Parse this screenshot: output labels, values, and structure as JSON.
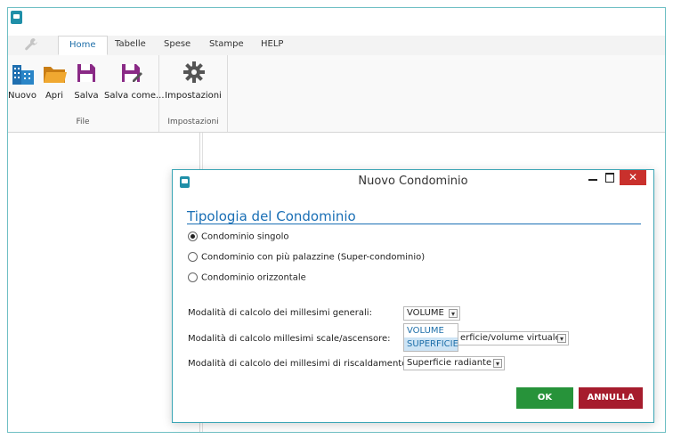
{
  "ribbon": {
    "tabs": [
      "Home",
      "Tabelle",
      "Spese",
      "Stampe",
      "HELP"
    ],
    "buttons": {
      "nuovo": "Nuovo",
      "apri": "Apri",
      "salva": "Salva",
      "salva_come": "Salva come...",
      "impostazioni": "Impostazioni"
    },
    "groups": {
      "file": "File",
      "impostazioni": "Impostazioni"
    }
  },
  "dialog": {
    "title": "Nuovo Condominio",
    "close_symbol": "✕",
    "section_title": "Tipologia del Condominio",
    "options": {
      "singolo": "Condominio singolo",
      "super": "Condominio con più palazzine (Super-condominio)",
      "orizzontale": "Condominio orizzontale"
    },
    "selected_option": "singolo",
    "fields": {
      "generali_label": "Modalità di calcolo dei millesimi generali:",
      "generali_value": "VOLUME",
      "scale_label": "Modalità di calcolo millesimi scale/ascensore:",
      "scale_value": "erficie/volume virtuale",
      "risc_label": "Modalità di calcolo dei millesimi di riscaldamento:",
      "risc_value": "Superficie radiante"
    },
    "dropdown_options": [
      "VOLUME",
      "SUPERFICIE"
    ],
    "ok_label": "OK",
    "cancel_label": "ANNULLA"
  },
  "colors": {
    "accent": "#1a6fb5",
    "ok": "#27933a",
    "cancel": "#a61c2d",
    "close": "#c9302c"
  }
}
